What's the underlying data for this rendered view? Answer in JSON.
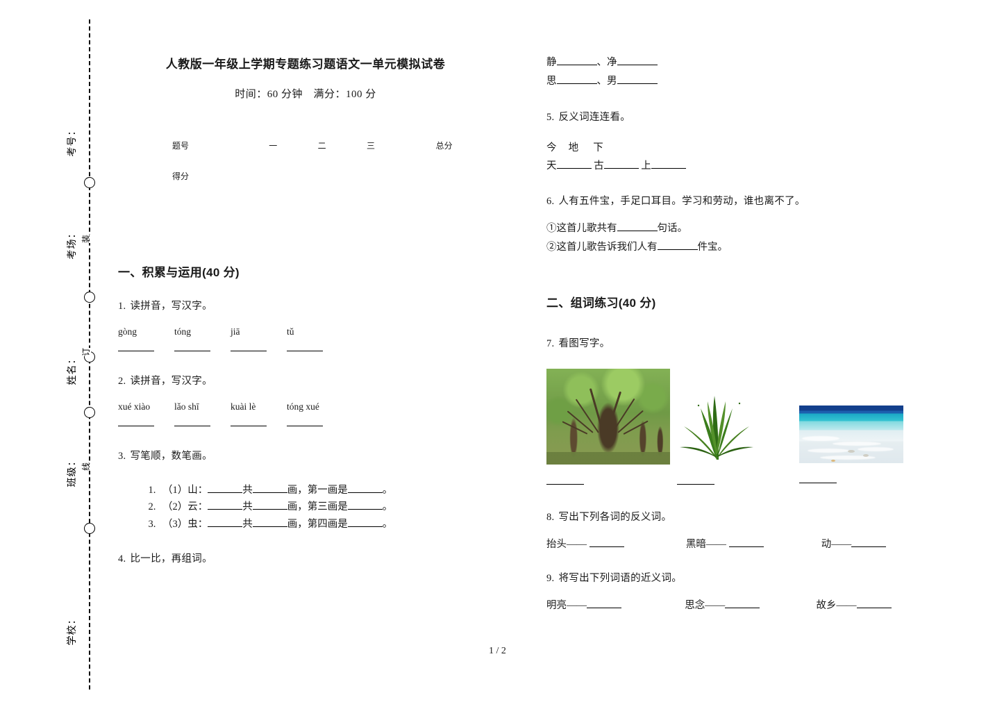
{
  "document": {
    "title": "人教版一年级上学期专题练习题语文一单元模拟试卷",
    "subtitle": "时间：60 分钟　满分：100 分",
    "footer": "1 / 2"
  },
  "margin": {
    "labels": [
      "考号：",
      "考场：",
      "姓名：",
      "班级：",
      "学校："
    ],
    "line_glyphs": [
      "装",
      "订",
      "线"
    ]
  },
  "score_table": {
    "row1_label": "题号",
    "columns": [
      "一",
      "二",
      "三",
      "总分"
    ],
    "row2_label": "得分"
  },
  "sections": {
    "one": {
      "heading": "一、积累与运用(40 分)"
    },
    "two": {
      "heading": "二、组词练习(40 分)"
    }
  },
  "questions": {
    "q1": {
      "num": "1.",
      "text": "读拼音，写汉字。",
      "pinyin": [
        "gòng",
        "tóng",
        "jiā",
        "tǔ"
      ]
    },
    "q2": {
      "num": "2.",
      "text": "读拼音，写汉字。",
      "pinyin": [
        "xué xiào",
        "lǎo shī",
        "kuài lè",
        "tóng xué"
      ]
    },
    "q3": {
      "num": "3.",
      "text": "写笔顺，数笔画。",
      "items": [
        {
          "marker": "1.",
          "label": "（1）山：",
          "mid": "共",
          "after": "画，第一画是",
          "end": "。"
        },
        {
          "marker": "2.",
          "label": "（2）云：",
          "mid": "共",
          "after": "画，第三画是",
          "end": "。"
        },
        {
          "marker": "3.",
          "label": "（3）虫：",
          "mid": "共",
          "after": "画，第四画是",
          "end": "。"
        }
      ]
    },
    "q4": {
      "num": "4.",
      "text": "比一比，再组词。",
      "pairs": [
        {
          "a": "静",
          "sep": "、",
          "b": "净"
        },
        {
          "a": "思",
          "sep": "、",
          "b": "男"
        }
      ]
    },
    "q5": {
      "num": "5.",
      "text": "反义词连连看。",
      "top": [
        "今",
        "地",
        "下"
      ],
      "bottom": [
        "天",
        "古",
        "上"
      ]
    },
    "q6": {
      "num": "6.",
      "text": "人有五件宝，手足口耳目。学习和劳动，谁也离不了。",
      "sub1_pre": "①这首儿歌共有",
      "sub1_post": "句话。",
      "sub2_pre": "②这首儿歌告诉我们人有",
      "sub2_post": "件宝。"
    },
    "q7": {
      "num": "7.",
      "text": "看图写字。",
      "pictures": [
        {
          "name": "forest-photo",
          "alt": "树林"
        },
        {
          "name": "grass-plant-illustration",
          "alt": "草"
        },
        {
          "name": "beach-photo",
          "alt": "沙滩海水"
        }
      ]
    },
    "q8": {
      "num": "8.",
      "text": "写出下列各词的反义词。",
      "items": [
        "抬头——",
        "黑暗——",
        "动——"
      ]
    },
    "q9": {
      "num": "9.",
      "text": "将写出下列词语的近义词。",
      "items": [
        "明亮——",
        "思念——",
        "故乡——"
      ]
    }
  }
}
